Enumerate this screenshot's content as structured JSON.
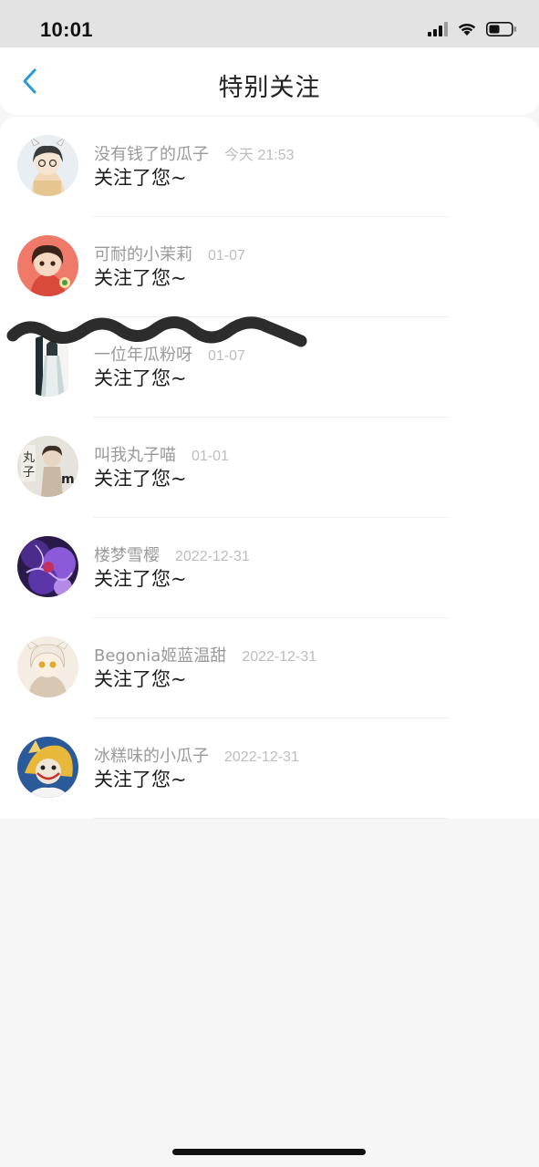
{
  "status_bar": {
    "time": "10:01",
    "icons": [
      "signal-icon",
      "wifi-icon",
      "battery-icon"
    ]
  },
  "nav": {
    "title": "特别关注",
    "back_icon": "chevron-left-icon"
  },
  "items": [
    {
      "name": "没有钱了的瓜子",
      "time": "今天 21:53",
      "action": "关注了您~",
      "avatar_colors": [
        "#e8eef2",
        "#3a3a3a",
        "#f3d8b8"
      ]
    },
    {
      "name": "可耐的小茉莉",
      "time": "01-07",
      "action": "关注了您~",
      "avatar_colors": [
        "#f07a6a",
        "#3b2418",
        "#f6d9c2"
      ]
    },
    {
      "name": "一位年瓜粉呀",
      "time": "01-07",
      "action": "关注了您~",
      "avatar_colors": [
        "#f4f4f2",
        "#2d3a3c",
        "#c9d6d8"
      ]
    },
    {
      "name": "叫我丸子喵",
      "time": "01-01",
      "action": "关注了您~",
      "avatar_colors": [
        "#e6e2dc",
        "#3d3026",
        "#c9b9a2"
      ]
    },
    {
      "name": "楼梦雪樱",
      "time": "2022-12-31",
      "action": "关注了您~",
      "avatar_colors": [
        "#4c2c8a",
        "#8a5ad8",
        "#2a1a4a"
      ]
    },
    {
      "name": "Begonia姬蓝温甜",
      "time": "2022-12-31",
      "action": "关注了您~",
      "avatar_colors": [
        "#f3ede4",
        "#d8c8b2",
        "#e0a830"
      ]
    },
    {
      "name": "冰糕味的小瓜子",
      "time": "2022-12-31",
      "action": "关注了您~",
      "avatar_colors": [
        "#2a5a9a",
        "#e8b83a",
        "#f0e6d6"
      ]
    }
  ],
  "colors": {
    "accent": "#2a9bd6",
    "name_text": "#9a9a9a",
    "time_text": "#bdbdbd",
    "action_text": "#1c1c1c",
    "background": "#f6f6f6"
  }
}
